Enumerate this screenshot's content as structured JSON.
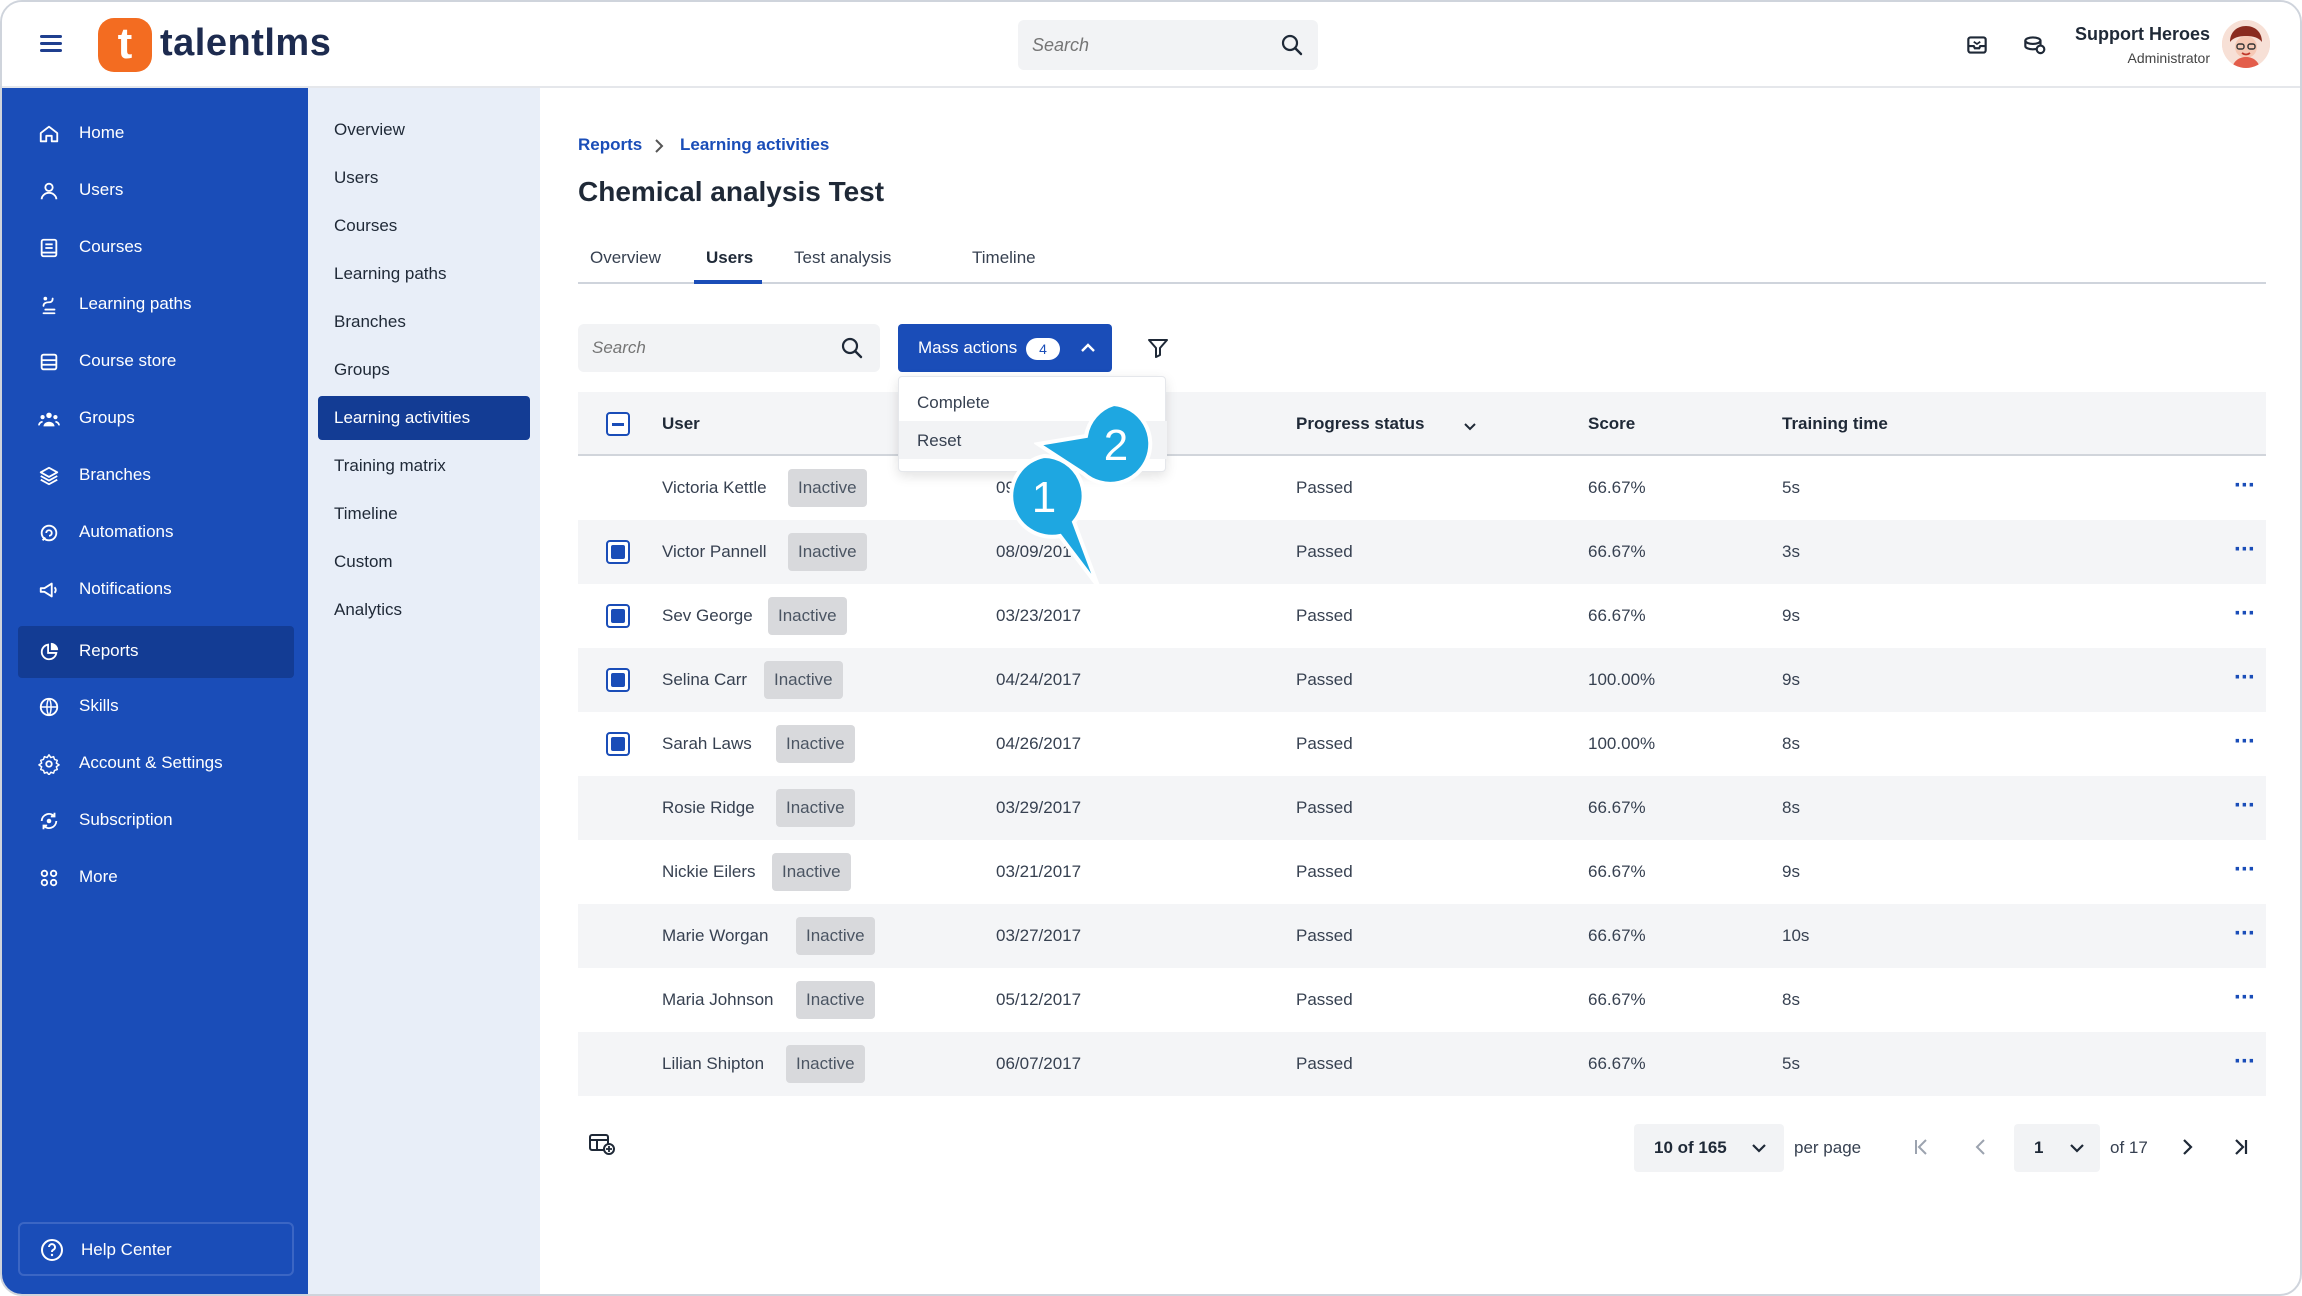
{
  "header": {
    "logo_mark": "t",
    "logo_text": "talentlms",
    "search_placeholder": "Search",
    "user_name": "Support Heroes",
    "user_role": "Administrator"
  },
  "sidebar": {
    "items": [
      {
        "label": "Home",
        "icon": "home-icon"
      },
      {
        "label": "Users",
        "icon": "user-icon"
      },
      {
        "label": "Courses",
        "icon": "book-icon"
      },
      {
        "label": "Learning paths",
        "icon": "path-icon"
      },
      {
        "label": "Course store",
        "icon": "store-icon"
      },
      {
        "label": "Groups",
        "icon": "group-icon"
      },
      {
        "label": "Branches",
        "icon": "layers-icon"
      },
      {
        "label": "Automations",
        "icon": "automation-icon"
      },
      {
        "label": "Notifications",
        "icon": "megaphone-icon"
      },
      {
        "label": "Reports",
        "icon": "pie-chart-icon",
        "active": true
      },
      {
        "label": "Skills",
        "icon": "globe-icon"
      },
      {
        "label": "Account & Settings",
        "icon": "gear-icon"
      },
      {
        "label": "Subscription",
        "icon": "subscription-icon"
      },
      {
        "label": "More",
        "icon": "grid-icon"
      }
    ],
    "help_center": "Help Center"
  },
  "subnav": {
    "items": [
      {
        "label": "Overview"
      },
      {
        "label": "Users"
      },
      {
        "label": "Courses"
      },
      {
        "label": "Learning paths"
      },
      {
        "label": "Branches"
      },
      {
        "label": "Groups"
      },
      {
        "label": "Learning activities",
        "active": true
      },
      {
        "label": "Training matrix"
      },
      {
        "label": "Timeline"
      },
      {
        "label": "Custom"
      },
      {
        "label": "Analytics"
      }
    ]
  },
  "main": {
    "breadcrumb": [
      "Reports",
      "Learning activities"
    ],
    "title": "Chemical analysis Test",
    "tabs": [
      {
        "label": "Overview"
      },
      {
        "label": "Users",
        "active": true
      },
      {
        "label": "Test analysis"
      },
      {
        "label": "Timeline"
      }
    ],
    "search_placeholder": "Search",
    "mass_actions": {
      "label": "Mass actions",
      "count": "4"
    },
    "dropdown": [
      "Complete",
      "Reset"
    ],
    "columns": [
      "User",
      "Progress status",
      "Score",
      "Training time"
    ],
    "rows": [
      {
        "user": "Victoria Kettle",
        "status": "Inactive",
        "date": "09/22/2017",
        "progress": "Passed",
        "score": "66.67%",
        "time": "5s",
        "checked": false
      },
      {
        "user": "Victor Pannell",
        "status": "Inactive",
        "date": "08/09/2017",
        "progress": "Passed",
        "score": "66.67%",
        "time": "3s",
        "checked": true
      },
      {
        "user": "Sev George",
        "status": "Inactive",
        "date": "03/23/2017",
        "progress": "Passed",
        "score": "66.67%",
        "time": "9s",
        "checked": true
      },
      {
        "user": "Selina Carr",
        "status": "Inactive",
        "date": "04/24/2017",
        "progress": "Passed",
        "score": "100.00%",
        "time": "9s",
        "checked": true
      },
      {
        "user": "Sarah Laws",
        "status": "Inactive",
        "date": "04/26/2017",
        "progress": "Passed",
        "score": "100.00%",
        "time": "8s",
        "checked": true
      },
      {
        "user": "Rosie Ridge",
        "status": "Inactive",
        "date": "03/29/2017",
        "progress": "Passed",
        "score": "66.67%",
        "time": "8s",
        "checked": false
      },
      {
        "user": "Nickie Eilers",
        "status": "Inactive",
        "date": "03/21/2017",
        "progress": "Passed",
        "score": "66.67%",
        "time": "9s",
        "checked": false
      },
      {
        "user": "Marie Worgan",
        "status": "Inactive",
        "date": "03/27/2017",
        "progress": "Passed",
        "score": "66.67%",
        "time": "10s",
        "checked": false
      },
      {
        "user": "Maria Johnson",
        "status": "Inactive",
        "date": "05/12/2017",
        "progress": "Passed",
        "score": "66.67%",
        "time": "8s",
        "checked": false
      },
      {
        "user": "Lilian Shipton",
        "status": "Inactive",
        "date": "06/07/2017",
        "progress": "Passed",
        "score": "66.67%",
        "time": "5s",
        "checked": false
      }
    ],
    "pagination": {
      "page_size": "10 of 165",
      "per_page_label": "per page",
      "current_page": "1",
      "of_pages": "of 17"
    }
  },
  "callouts": [
    "1",
    "2"
  ],
  "colors": {
    "brand_blue": "#1a4db8",
    "brand_orange": "#f36c21",
    "callout_blue": "#1ea7e1",
    "active_nav": "#133c94"
  }
}
